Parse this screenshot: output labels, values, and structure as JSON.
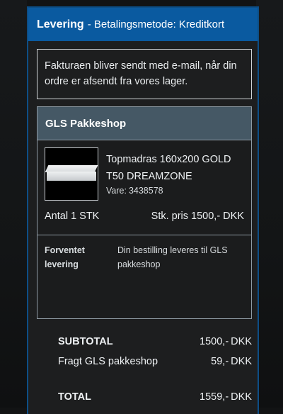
{
  "header": {
    "title": "Levering",
    "subtitle": "- Betalingsmetode: Kreditkort"
  },
  "info_text": "Fakturaen bliver sendt med e-mail, når din ordre er afsendt fra vores lager.",
  "shipping": {
    "method_title": "GLS Pakkeshop",
    "product": {
      "image_icon": "mattress-image",
      "name": "Topmadras 160x200 GOLD T50 DREAMZONE",
      "sku_label": "Vare:",
      "sku": "3438578"
    },
    "quantity_label": "Antal",
    "quantity": "1 STK",
    "unit_price_label": "Stk. pris",
    "unit_price": "1500,- DKK",
    "expected_label": "Forventet levering",
    "expected_text": "Din bestilling leveres til GLS pakkeshop"
  },
  "totals": {
    "subtotal_label": "SUBTOTAL",
    "subtotal_value": "1500,-",
    "shipping_label": "Fragt GLS pakkeshop",
    "shipping_value": "59,-",
    "total_label": "TOTAL",
    "total_value": "1559,-",
    "currency": "DKK"
  },
  "colors": {
    "header_bg": "#0a5aa0",
    "panel_border": "#0d4e86",
    "shipping_header_bg": "#455865"
  }
}
